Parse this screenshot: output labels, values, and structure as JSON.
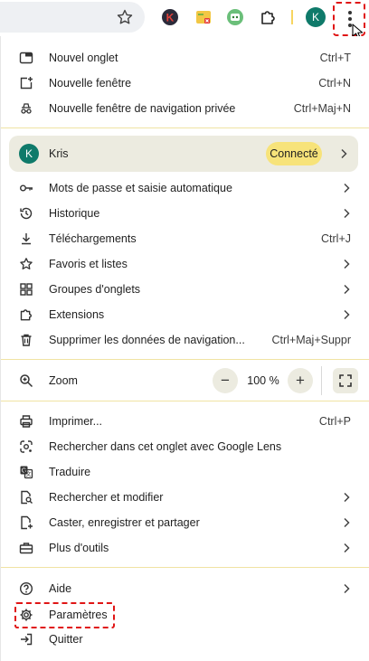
{
  "toolbar": {
    "avatar_initial": "K",
    "extension_icons": [
      "k-extension-icon",
      "color-extension-icon",
      "robot-extension-icon",
      "puzzle-icon"
    ]
  },
  "menu": {
    "new_tab": {
      "label": "Nouvel onglet",
      "shortcut": "Ctrl+T"
    },
    "new_window": {
      "label": "Nouvelle fenêtre",
      "shortcut": "Ctrl+N"
    },
    "incognito": {
      "label": "Nouvelle fenêtre de navigation privée",
      "shortcut": "Ctrl+Maj+N"
    },
    "profile": {
      "initial": "K",
      "name": "Kris",
      "status": "Connecté"
    },
    "passwords": {
      "label": "Mots de passe et saisie automatique"
    },
    "history": {
      "label": "Historique"
    },
    "downloads": {
      "label": "Téléchargements",
      "shortcut": "Ctrl+J"
    },
    "bookmarks": {
      "label": "Favoris et listes"
    },
    "tab_groups": {
      "label": "Groupes d'onglets"
    },
    "extensions": {
      "label": "Extensions"
    },
    "clear_data": {
      "label": "Supprimer les données de navigation...",
      "shortcut": "Ctrl+Maj+Suppr"
    },
    "zoom": {
      "label": "Zoom",
      "value": "100 %",
      "minus": "−",
      "plus": "+"
    },
    "print": {
      "label": "Imprimer...",
      "shortcut": "Ctrl+P"
    },
    "lens": {
      "label": "Rechercher dans cet onglet avec Google Lens"
    },
    "translate": {
      "label": "Traduire"
    },
    "find": {
      "label": "Rechercher et modifier"
    },
    "cast": {
      "label": "Caster, enregistrer et partager"
    },
    "more_tools": {
      "label": "Plus d'outils"
    },
    "help": {
      "label": "Aide"
    },
    "settings": {
      "label": "Paramètres"
    },
    "quit": {
      "label": "Quitter"
    }
  },
  "colors": {
    "accent": "#0f7a6a",
    "badge": "#f7e37a",
    "highlight": "#e01515",
    "divider": "#f0e3a3"
  }
}
